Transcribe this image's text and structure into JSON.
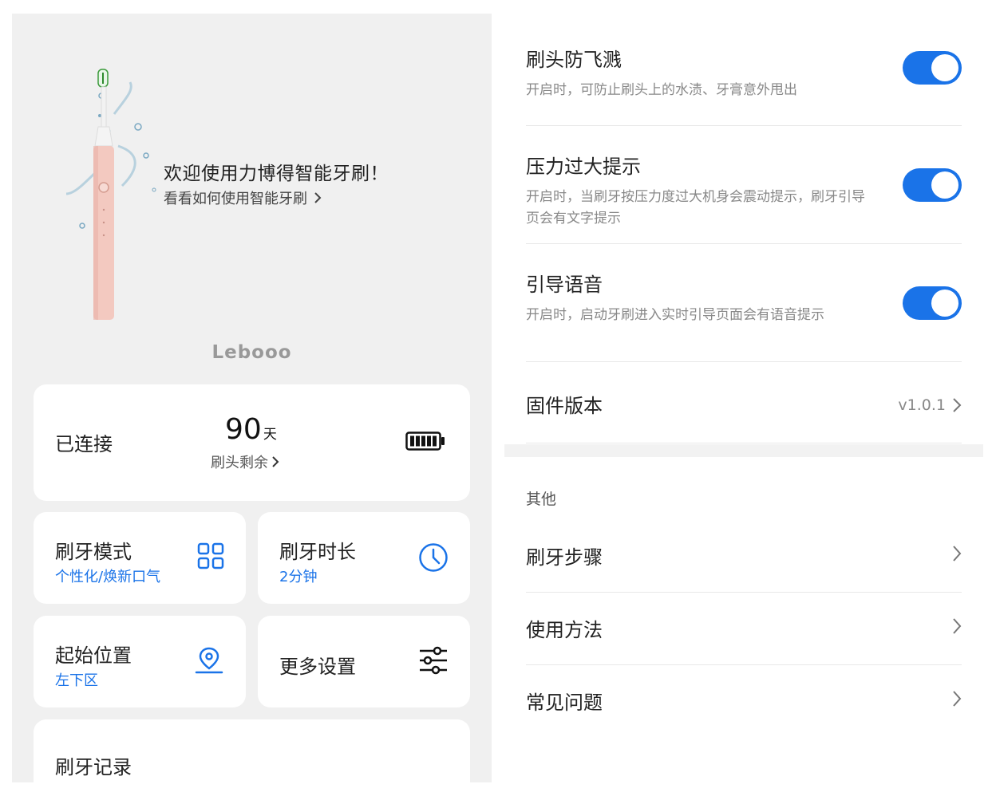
{
  "welcome": {
    "title": "欢迎使用力博得智能牙刷！",
    "link": "看看如何使用智能牙刷"
  },
  "brand": "Lebooo",
  "status": {
    "connection": "已连接",
    "days_value": "90",
    "days_unit": "天",
    "head_remaining": "刷头剩余"
  },
  "tiles": {
    "mode": {
      "title": "刷牙模式",
      "value": "个性化/焕新口气"
    },
    "duration": {
      "title": "刷牙时长",
      "value": "2分钟"
    },
    "position": {
      "title": "起始位置",
      "value": "左下区"
    },
    "more": {
      "title": "更多设置"
    }
  },
  "records": {
    "title": "刷牙记录"
  },
  "settings": {
    "splash": {
      "title": "刷头防飞溅",
      "desc": "开启时，可防止刷头上的水渍、牙膏意外甩出"
    },
    "pressure": {
      "title": "压力过大提示",
      "desc": "开启时，当刷牙按压力度过大机身会震动提示，刷牙引导页会有文字提示"
    },
    "voice": {
      "title": "引导语音",
      "desc": "开启时，启动牙刷进入实时引导页面会有语音提示"
    },
    "firmware": {
      "title": "固件版本",
      "value": "v1.0.1"
    }
  },
  "other": {
    "section_title": "其他",
    "items": [
      "刷牙步骤",
      "使用方法",
      "常见问题"
    ]
  },
  "colors": {
    "accent": "#1a73e8",
    "brush_pink": "#f3c9c0"
  }
}
